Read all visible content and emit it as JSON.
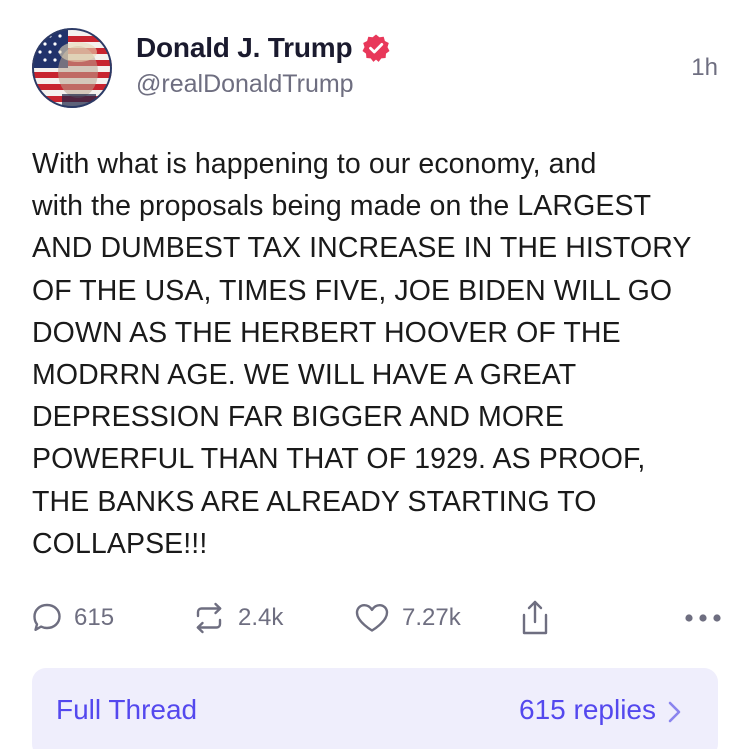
{
  "author": {
    "display_name": "Donald J. Trump",
    "handle": "@realDonaldTrump",
    "verified": true,
    "avatar_icon": "avatar-flag-portrait"
  },
  "timestamp": "1h",
  "post": {
    "text": "With what is happening to our economy, and\nwith the proposals being made on the LARGEST\nAND DUMBEST TAX INCREASE IN THE HISTORY\nOF THE USA, TIMES FIVE, JOE BIDEN WILL GO\nDOWN AS THE HERBERT HOOVER OF THE\nMODRRN AGE. WE WILL HAVE A GREAT\nDEPRESSION FAR BIGGER AND MORE\nPOWERFUL THAN THAT OF 1929. AS PROOF,\nTHE BANKS ARE ALREADY STARTING TO\nCOLLAPSE!!!"
  },
  "actions": {
    "reply_count": "615",
    "retruth_count": "2.4k",
    "like_count": "7.27k",
    "icons": [
      "reply-icon",
      "retruth-icon",
      "heart-icon",
      "share-icon",
      "more-icon"
    ]
  },
  "thread": {
    "label": "Full Thread",
    "replies_label": "615 replies"
  },
  "colors": {
    "verified_badge": "#e8385a",
    "accent": "#5448ee",
    "thread_bg": "#efeefc",
    "muted": "#6e6e80"
  }
}
